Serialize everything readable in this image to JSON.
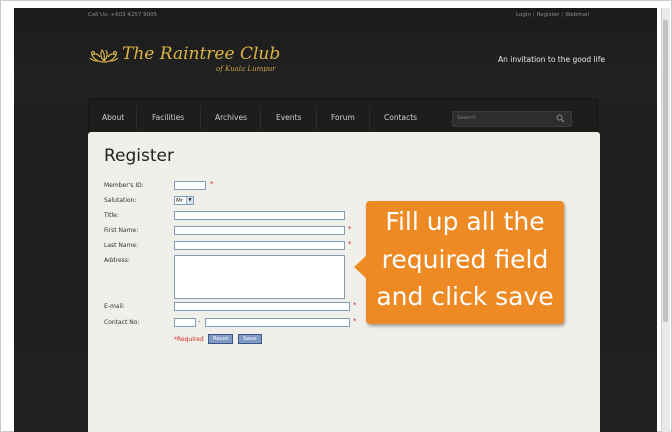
{
  "topbar": {
    "call_us": "Call Us: +603 4257 9005",
    "links": [
      "Login",
      "Register",
      "Webmail"
    ]
  },
  "brand": {
    "title": "The Raintree Club",
    "subtitle": "of Kuala Lumpur",
    "tagline": "An invitation to the good life",
    "logo_icon": "leaf-ornament-icon",
    "accent_color": "#d6b04a"
  },
  "nav": {
    "items": [
      "About",
      "Facilities",
      "Archives",
      "Events",
      "Forum",
      "Contacts"
    ],
    "search_placeholder": "Search",
    "search_icon": "magnifier-icon"
  },
  "form": {
    "title": "Register",
    "labels": {
      "member_id": "Member's ID:",
      "salutation": "Salutation:",
      "title": "Title:",
      "first_name": "First Name:",
      "last_name": "Last Name:",
      "address": "Address:",
      "email": "E-mail:",
      "contact": "Contact No:"
    },
    "salutation_value": "Mr",
    "required_marker": "*",
    "required_note": "*Required",
    "reset_label": "Reset",
    "save_label": "Save",
    "contact_separator": "-"
  },
  "callout": {
    "lines": [
      "Fill up all the",
      "required field",
      "and click save"
    ],
    "color": "#ee8a23"
  }
}
